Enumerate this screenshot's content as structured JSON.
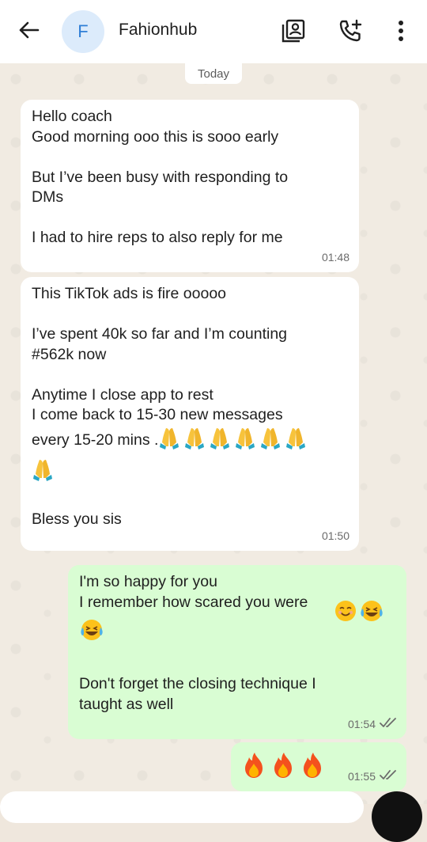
{
  "header": {
    "avatar_initial": "F",
    "contact_name": "Fahionhub"
  },
  "chat": {
    "date_label": "Today",
    "messages": [
      {
        "direction": "in",
        "text": "Hello coach\nGood morning ooo this is sooo early\n\nBut I’ve been busy with responding to\nDMs\n\nI had to hire reps to also reply for me",
        "time": "01:48"
      },
      {
        "direction": "in",
        "text_a": "This TikTok ads is fire ooooo\n\nI’ve spent 40k so far and I’m counting\n#562k now\n\nAnytime I close app to rest\nI come back to 15-30 new messages",
        "text_b": "every 15-20 mins .",
        "emoji": "folded-hands x7",
        "text_c": "Bless you sis",
        "time": "01:50"
      },
      {
        "direction": "out",
        "text_a": "I'm so happy for you\nI remember how scared you were",
        "emoji": "smiling-face, face-with-tears-of-joy x2",
        "text_b": "Don't forget the closing technique I\ntaught as well",
        "time": "01:54",
        "status": "read"
      },
      {
        "direction": "out",
        "emoji": "fire x3",
        "time": "01:55",
        "status": "read"
      }
    ]
  },
  "colors": {
    "incoming_bubble": "#ffffff",
    "outgoing_bubble": "#d9fdd3",
    "read_tick": "#6b6b6b",
    "avatar_bg": "#dcebfb",
    "avatar_fg": "#2f7fd6"
  },
  "icons": [
    "back-arrow-icon",
    "contact-card-icon",
    "add-call-icon",
    "more-vert-icon",
    "double-check-icon"
  ]
}
